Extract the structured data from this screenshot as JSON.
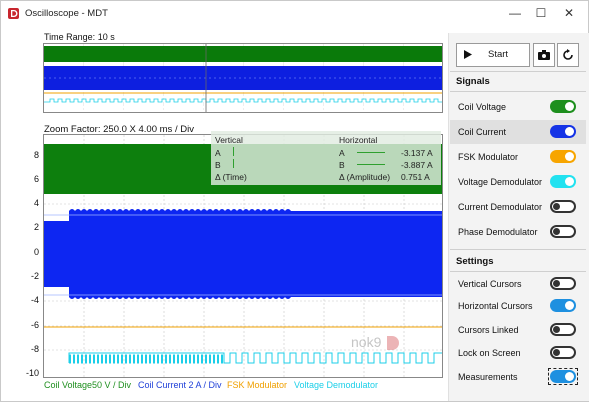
{
  "window": {
    "title": "Oscilloscope - MDT",
    "minimize": "—",
    "maximize": "☐",
    "close": "✕"
  },
  "overview": {
    "label": "Time Range: 10 s"
  },
  "zoom": {
    "label": "Zoom Factor: 250.0 X  4.00 ms / Div",
    "y_ticks": [
      "8",
      "6",
      "4",
      "2",
      "0",
      "-2",
      "-4",
      "-6",
      "-8",
      "-10"
    ]
  },
  "cursors": {
    "vertical_title": "Vertical",
    "horizontal_title": "Horizontal",
    "v_a": "A",
    "v_b": "B",
    "v_delta": "Δ (Time)",
    "h_a": "A",
    "h_a_value": "-3.137 A",
    "h_b": "B",
    "h_b_value": "-3.887 A",
    "h_delta": "Δ (Amplitude)",
    "h_delta_value": "0.751 A"
  },
  "legend": [
    {
      "text": "Coil Voltage50 V / Div",
      "color": "#1e8f1e"
    },
    {
      "text": "Coil Current 2 A / Div",
      "color": "#1e3fd8"
    },
    {
      "text": "FSK Modulator",
      "color": "#f0a000"
    },
    {
      "text": "Voltage Demodulator",
      "color": "#1ccfe8"
    }
  ],
  "watermark": "nok9",
  "controls": {
    "start_label": "Start",
    "camera_icon": "camera-icon",
    "reset_icon": "refresh-icon"
  },
  "signals": {
    "title": "Signals",
    "items": [
      {
        "label": "Coil Voltage",
        "on": true,
        "color": "#1e8f1e"
      },
      {
        "label": "Coil Current",
        "on": true,
        "color": "#1533e6"
      },
      {
        "label": "FSK Modulator",
        "on": true,
        "color": "#f7a500"
      },
      {
        "label": "Voltage Demodulator",
        "on": true,
        "color": "#22e2f0"
      },
      {
        "label": "Current Demodulator",
        "on": false,
        "color": "#333333"
      },
      {
        "label": "Phase Demodulator",
        "on": false,
        "color": "#333333"
      }
    ]
  },
  "settings": {
    "title": "Settings",
    "items": [
      {
        "label": "Vertical Cursors",
        "on": false,
        "color": "#333333"
      },
      {
        "label": "Horizontal Cursors",
        "on": true,
        "color": "#1e90e0"
      },
      {
        "label": "Cursors Linked",
        "on": false,
        "color": "#333333"
      },
      {
        "label": "Lock on Screen",
        "on": false,
        "color": "#333333"
      },
      {
        "label": "Measurements",
        "on": true,
        "color": "#1e90e0"
      }
    ]
  }
}
